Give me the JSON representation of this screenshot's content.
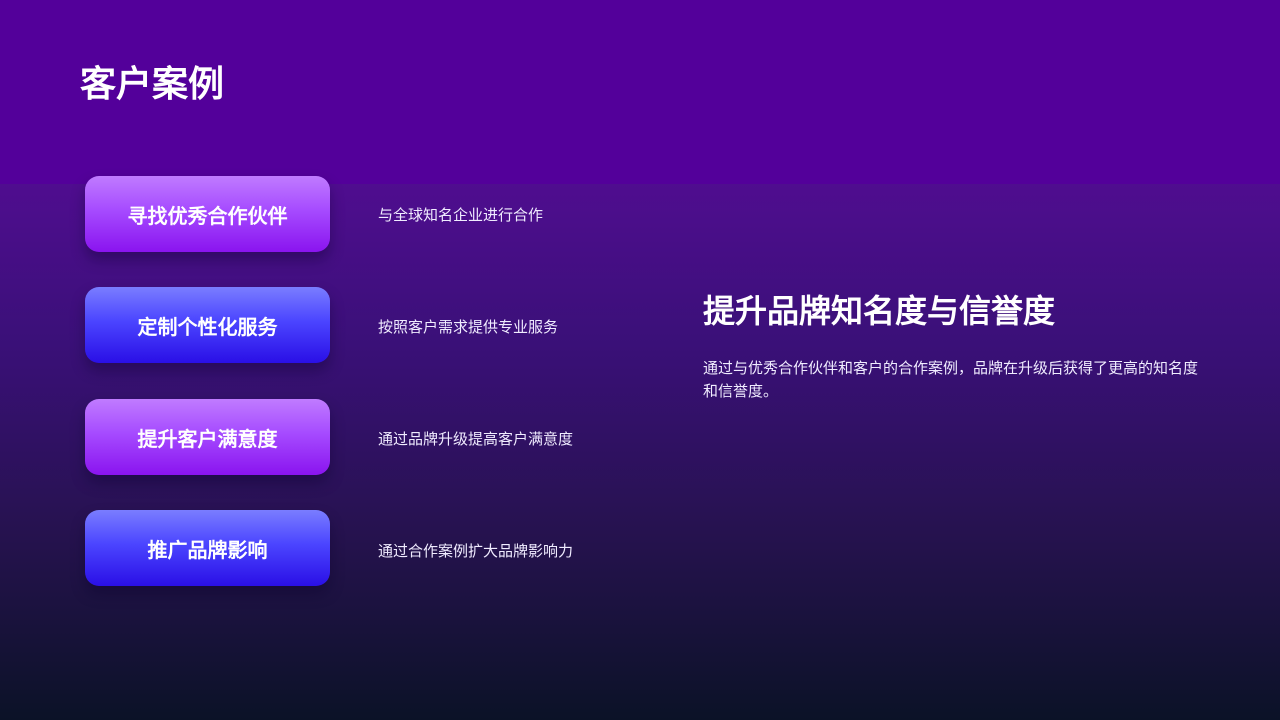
{
  "page": {
    "title": "客户案例"
  },
  "items": [
    {
      "label": "寻找优秀合作伙伴",
      "description": "与全球知名企业进行合作"
    },
    {
      "label": "定制个性化服务",
      "description": "按照客户需求提供专业服务"
    },
    {
      "label": "提升客户满意度",
      "description": "通过品牌升级提高客户满意度"
    },
    {
      "label": "推广品牌影响",
      "description": "通过合作案例扩大品牌影响力"
    }
  ],
  "feature": {
    "title": "提升品牌知名度与信誉度",
    "body": "通过与优秀合作伙伴和客户的合作案例，品牌在升级后获得了更高的知名度和信誉度。"
  },
  "colors": {
    "background_top": "#53009a",
    "button_purple": "#a64bff",
    "button_blue": "#4b45ff"
  }
}
